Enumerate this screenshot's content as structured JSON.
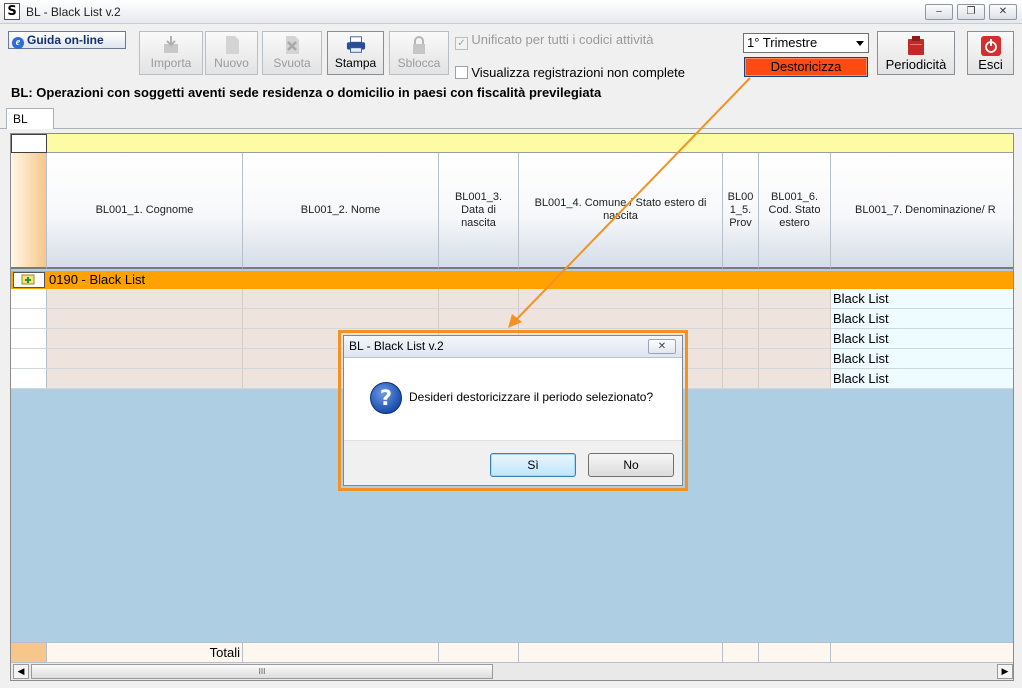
{
  "window": {
    "title": "BL - Black List v.2",
    "minimize": "–",
    "maximize": "❐",
    "close": "✕"
  },
  "toolbar": {
    "guida_label": "Guida on-line",
    "importa": "Importa",
    "nuovo": "Nuovo",
    "svuota": "Svuota",
    "stampa": "Stampa",
    "sblocca": "Sblocca",
    "unificato_label": "Unificato per tutti i codici attività",
    "unificato_checked": true,
    "visualizza_label": "Visualizza registrazioni non complete",
    "visualizza_checked": false,
    "period_select": "1° Trimestre",
    "destoricizza": "Destoricizza",
    "periodicita": "Periodicità",
    "esci": "Esci"
  },
  "heading": "BL: Operazioni con soggetti aventi sede residenza o domicilio in paesi con fiscalità previlegiata",
  "tabs": [
    "BL"
  ],
  "grid": {
    "columns": [
      "BL001_1. Cognome",
      "BL001_2. Nome",
      "BL001_3. Data di nascita",
      "BL001_4. Comune / Stato estero di nascita",
      "BL001_5. Prov",
      "BL001_6. Cod. Stato estero",
      "BL001_7. Denominazione/ R"
    ],
    "group_label": "0190 - Black List",
    "rows": [
      "Black List",
      "Black List",
      "Black List",
      "Black List",
      "Black List"
    ],
    "totals_label": "Totali",
    "scroll_thumb": "III"
  },
  "dialog": {
    "title": "BL - Black List v.2",
    "close": "✕",
    "message": "Desideri destoricizzare il periodo selezionato?",
    "yes": "Sì",
    "no": "No"
  },
  "colors": {
    "destoricizza_bg": "#ff4a12",
    "highlight_frame": "#f39224",
    "group_row": "#ffa200",
    "grid_bg": "#aecee4"
  }
}
